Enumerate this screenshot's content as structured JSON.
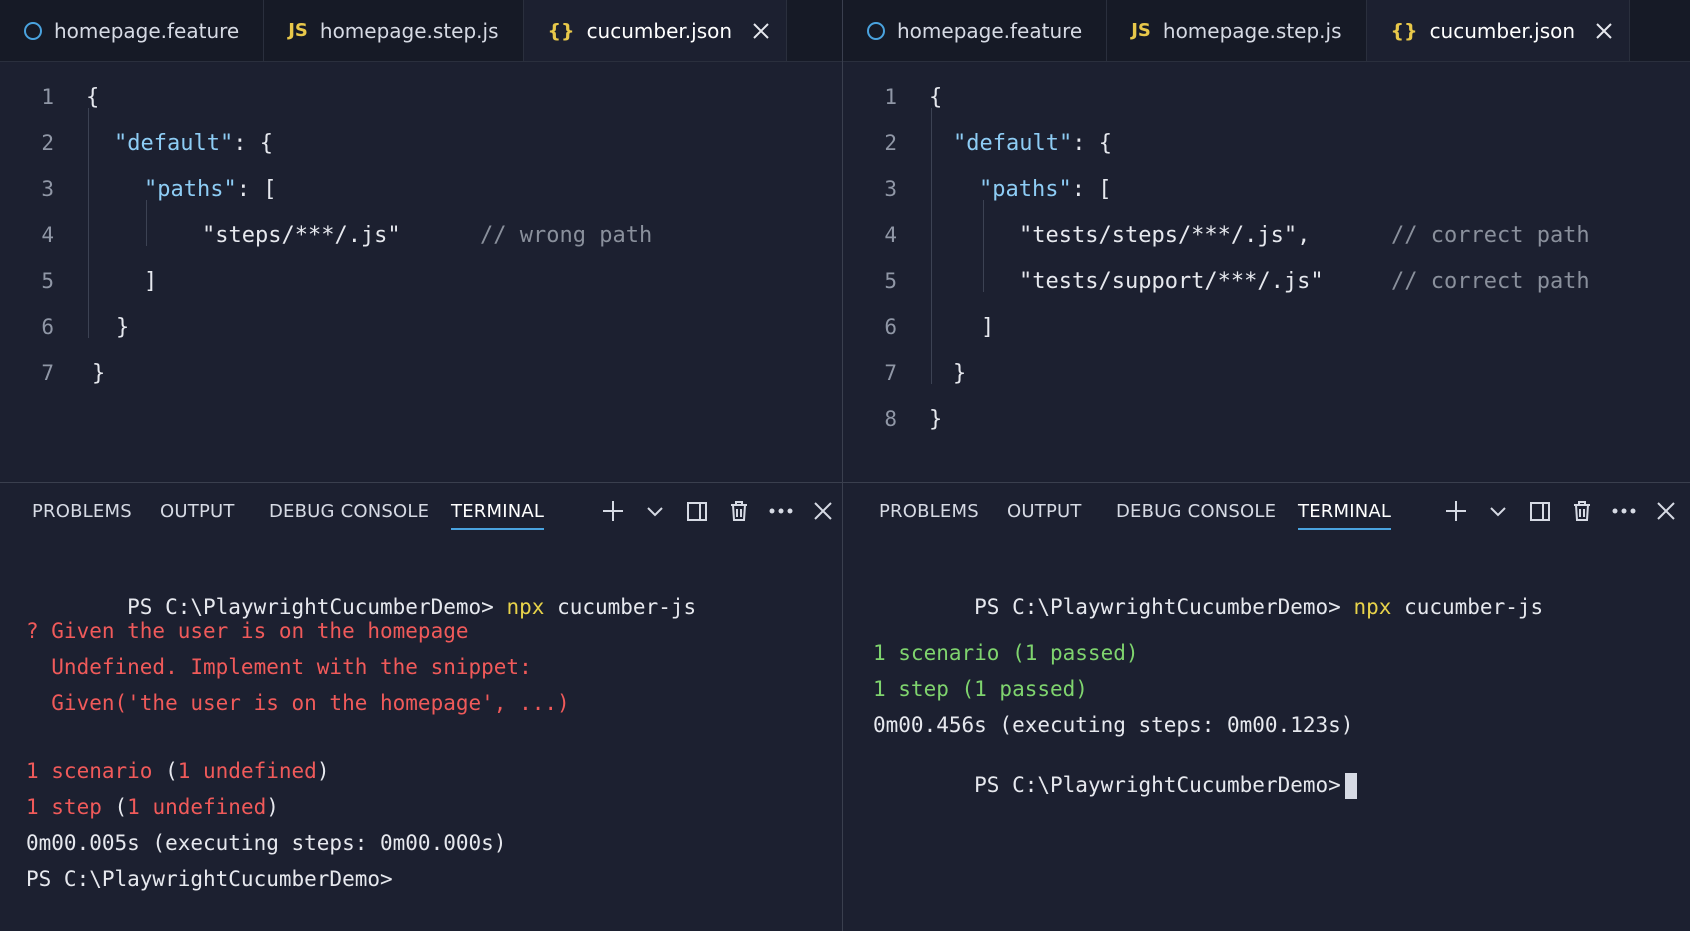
{
  "left": {
    "tabs": [
      {
        "label": "homepage.feature",
        "icon": "feature-file-icon"
      },
      {
        "label": "homepage.step.js",
        "icon": "js-file-icon",
        "icon_text": "JS"
      },
      {
        "label": "cucumber.json",
        "icon": "json-file-icon",
        "icon_text": "{}",
        "active": true
      }
    ],
    "editor": {
      "line_numbers": [
        "1",
        "2",
        "3",
        "4",
        "5",
        "6",
        "7"
      ],
      "open_brace": "{",
      "default_key": "\"default\"",
      "colon_brace": ": {",
      "paths_key": "\"paths\"",
      "colon_bracket": ": [",
      "path_value": "\"steps/***/.js\"",
      "path_comment": "// wrong path",
      "close_bracket": "]",
      "close_inner_brace": "}",
      "close_brace": "}"
    },
    "panel": {
      "tabs": [
        "PROBLEMS",
        "OUTPUT",
        "DEBUG CONSOLE",
        "TERMINAL"
      ],
      "active": "TERMINAL"
    },
    "terminal": {
      "prompt": "PS C:\\PlaywrightCucumberDemo>",
      "cmd_npx": "npx",
      "cmd_rest": "cucumber-js",
      "error_line1": "? Given the user is on the homepage",
      "error_line2": "  Undefined. Implement with the snippet:",
      "error_line3": "  Given('the user is on the homepage', ...)",
      "scenario_prefix": "1 scenario",
      "scenario_open": " (",
      "scenario_detail": "1 undefined",
      "scenario_close": ")",
      "step_prefix": "1 step",
      "step_open": " (",
      "step_detail": "1 undefined",
      "step_close": ")",
      "timing": "0m00.005s (executing steps: 0m00.000s)",
      "final_prompt": "PS C:\\PlaywrightCucumberDemo>"
    }
  },
  "right": {
    "tabs": [
      {
        "label": "homepage.feature",
        "icon": "feature-file-icon"
      },
      {
        "label": "homepage.step.js",
        "icon": "js-file-icon",
        "icon_text": "JS"
      },
      {
        "label": "cucumber.json",
        "icon": "json-file-icon",
        "icon_text": "{}",
        "active": true
      }
    ],
    "editor": {
      "line_numbers": [
        "1",
        "2",
        "3",
        "4",
        "5",
        "6",
        "7",
        "8"
      ],
      "open_brace": "{",
      "default_key": "\"default\"",
      "colon_brace": ": {",
      "paths_key": "\"paths\"",
      "colon_bracket": ": [",
      "path_value1": "\"tests/steps/***/.js\",",
      "path_comment1": "// correct path",
      "path_value2": "\"tests/support/***/.js\"",
      "path_comment2": "// correct path",
      "close_bracket": "]",
      "close_inner_brace": "}",
      "close_brace": "}"
    },
    "panel": {
      "tabs": [
        "PROBLEMS",
        "OUTPUT",
        "DEBUG CONSOLE",
        "TERMINAL"
      ],
      "active": "TERMINAL"
    },
    "terminal": {
      "prompt": "PS C:\\PlaywrightCucumberDemo>",
      "cmd_npx": "npx",
      "cmd_rest": "cucumber-js",
      "scenario": "1 scenario (1 passed)",
      "step": "1 step (1 passed)",
      "timing": "0m00.456s (executing steps: 0m00.123s)",
      "final_prompt": "PS C:\\PlaywrightCucumberDemo>"
    }
  },
  "colors": {
    "background": "#1c2030",
    "json_key": "#8ecdf5",
    "comment": "#8a909c",
    "error": "#f05a5a",
    "success": "#7fd46e",
    "command": "#e8d34a",
    "accent": "#4aa3df"
  }
}
